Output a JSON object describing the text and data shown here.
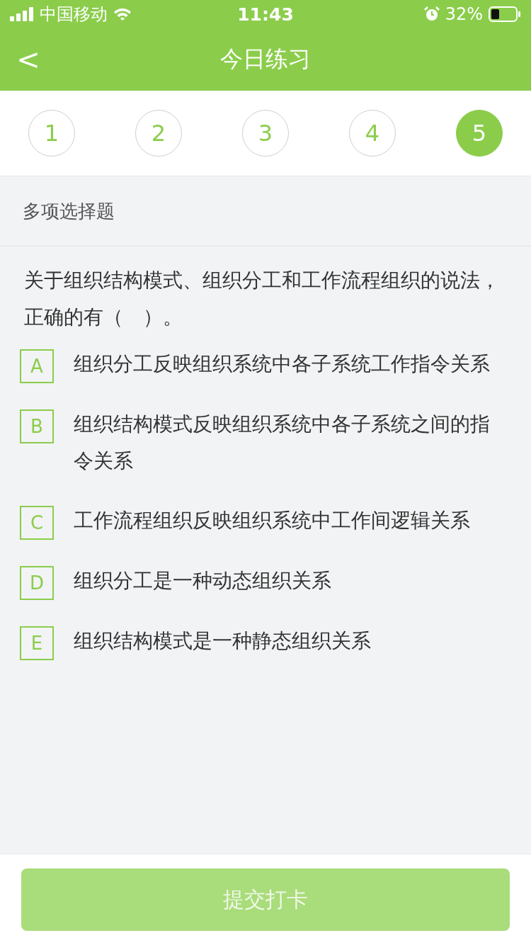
{
  "status_bar": {
    "carrier": "中国移动",
    "time": "11:43",
    "battery": "32%"
  },
  "header": {
    "back": "<",
    "title": "今日练习"
  },
  "steps": [
    {
      "label": "1",
      "selected": false
    },
    {
      "label": "2",
      "selected": false
    },
    {
      "label": "3",
      "selected": false
    },
    {
      "label": "4",
      "selected": false
    },
    {
      "label": "5",
      "selected": true
    }
  ],
  "section": {
    "title": "多项选择题"
  },
  "question": {
    "text": "关于组织结构模式、组织分工和工作流程组织的说法，正确的有（　）。"
  },
  "options": [
    {
      "letter": "A",
      "text": "组织分工反映组织系统中各子系统工作指令关系",
      "selected": false
    },
    {
      "letter": "B",
      "text": "组织结构模式反映组织系统中各子系统之间的指令关系",
      "selected": false
    },
    {
      "letter": "C",
      "text": "工作流程组织反映组织系统中工作间逻辑关系",
      "selected": false
    },
    {
      "letter": "D",
      "text": "组织分工是一种动态组织关系",
      "selected": false
    },
    {
      "letter": "E",
      "text": "组织结构模式是一种静态组织关系",
      "selected": false
    }
  ],
  "submit": {
    "label": "提交打卡",
    "disabled": true
  }
}
